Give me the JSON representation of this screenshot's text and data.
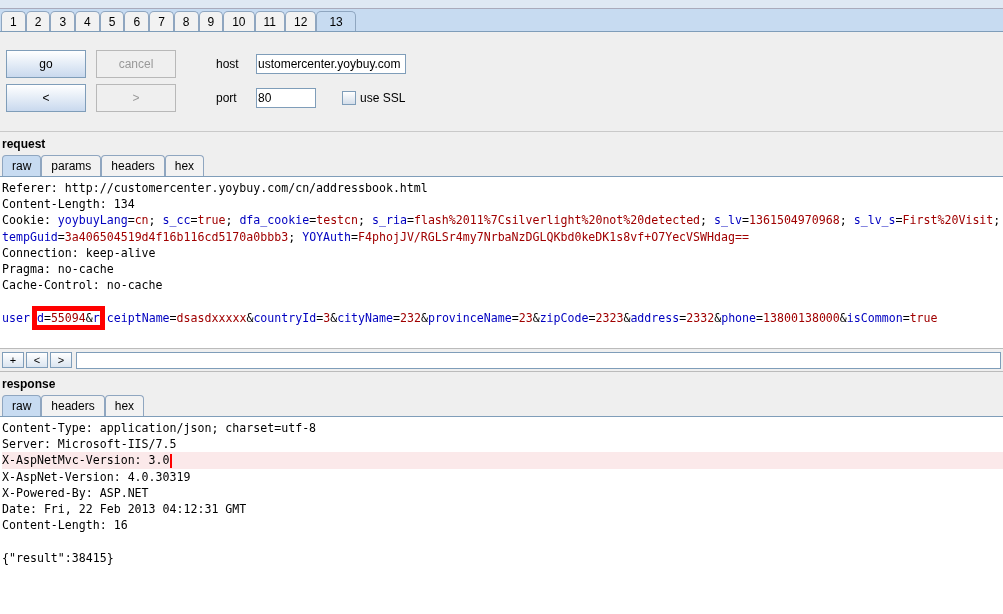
{
  "tabs": [
    {
      "label": "1",
      "selected": false
    },
    {
      "label": "2",
      "selected": false
    },
    {
      "label": "3",
      "selected": false
    },
    {
      "label": "4",
      "selected": false
    },
    {
      "label": "5",
      "selected": false
    },
    {
      "label": "6",
      "selected": false
    },
    {
      "label": "7",
      "selected": false
    },
    {
      "label": "8",
      "selected": false
    },
    {
      "label": "9",
      "selected": false
    },
    {
      "label": "10",
      "selected": false
    },
    {
      "label": "11",
      "selected": false
    },
    {
      "label": "12",
      "selected": false
    },
    {
      "label": "13",
      "selected": true
    }
  ],
  "controls": {
    "buttons": [
      {
        "label": "go",
        "disabled": false
      },
      {
        "label": "cancel",
        "disabled": true
      },
      {
        "label": "<",
        "disabled": false
      },
      {
        "label": ">",
        "disabled": true
      }
    ],
    "host": {
      "label": "host",
      "value": "ustomercenter.yoybuy.com"
    },
    "port": {
      "label": "port",
      "value": "80"
    },
    "ssl": {
      "label": "use SSL",
      "checked": false
    }
  },
  "request": {
    "title": "request",
    "tabs": [
      {
        "label": "raw",
        "selected": true
      },
      {
        "label": "params",
        "selected": false
      },
      {
        "label": "headers",
        "selected": false
      },
      {
        "label": "hex",
        "selected": false
      }
    ],
    "lines": [
      [
        {
          "kind": "plain",
          "text": "Referer: http://customercenter.yoybuy.com/cn/addressbook.html"
        }
      ],
      [
        {
          "kind": "plain",
          "text": "Content-Length: 134"
        }
      ],
      [
        {
          "kind": "plain",
          "text": "Cookie: "
        },
        {
          "kind": "key",
          "text": "yoybuyLang"
        },
        {
          "kind": "sep",
          "text": "="
        },
        {
          "kind": "value",
          "text": "cn"
        },
        {
          "kind": "sep",
          "text": "; "
        },
        {
          "kind": "key",
          "text": "s_cc"
        },
        {
          "kind": "sep",
          "text": "="
        },
        {
          "kind": "value",
          "text": "true"
        },
        {
          "kind": "sep",
          "text": "; "
        },
        {
          "kind": "key",
          "text": "dfa_cookie"
        },
        {
          "kind": "sep",
          "text": "="
        },
        {
          "kind": "value",
          "text": "testcn"
        },
        {
          "kind": "sep",
          "text": "; "
        },
        {
          "kind": "key",
          "text": "s_ria"
        },
        {
          "kind": "sep",
          "text": "="
        },
        {
          "kind": "value",
          "text": "flash%2011%7Csilverlight%20not%20detected"
        },
        {
          "kind": "sep",
          "text": "; "
        },
        {
          "kind": "key",
          "text": "s_lv"
        },
        {
          "kind": "sep",
          "text": "="
        },
        {
          "kind": "value",
          "text": "1361504970968"
        },
        {
          "kind": "sep",
          "text": "; "
        },
        {
          "kind": "key",
          "text": "s_lv_s"
        },
        {
          "kind": "sep",
          "text": "="
        },
        {
          "kind": "value",
          "text": "First%20Visit"
        },
        {
          "kind": "sep",
          "text": ";"
        }
      ],
      [
        {
          "kind": "key",
          "text": "tempGuid"
        },
        {
          "kind": "sep",
          "text": "="
        },
        {
          "kind": "value",
          "text": "3a406504519d4f16b116cd5170a0bbb3"
        },
        {
          "kind": "sep",
          "text": "; "
        },
        {
          "kind": "key",
          "text": "YOYAuth"
        },
        {
          "kind": "sep",
          "text": "="
        },
        {
          "kind": "value",
          "text": "F4phojJV/RGLSr4my7NrbaNzDGLQKbd0keDK1s8vf+O7YecVSWHdag=="
        }
      ],
      [
        {
          "kind": "plain",
          "text": "Connection: keep-alive"
        }
      ],
      [
        {
          "kind": "plain",
          "text": "Pragma: no-cache"
        }
      ],
      [
        {
          "kind": "plain",
          "text": "Cache-Control: no-cache"
        }
      ]
    ],
    "body": [
      {
        "kind": "key",
        "text": "user"
      },
      {
        "kind": "mark",
        "children": [
          {
            "kind": "key",
            "text": "d"
          },
          {
            "kind": "sep",
            "text": "="
          },
          {
            "kind": "value",
            "text": "55094"
          },
          {
            "kind": "sep",
            "text": "&"
          },
          {
            "kind": "key",
            "text": "r"
          }
        ]
      },
      {
        "kind": "key",
        "text": "ceiptName"
      },
      {
        "kind": "sep",
        "text": "="
      },
      {
        "kind": "value",
        "text": "dsasdxxxxx"
      },
      {
        "kind": "sep",
        "text": "&"
      },
      {
        "kind": "key",
        "text": "countryId"
      },
      {
        "kind": "sep",
        "text": "="
      },
      {
        "kind": "value",
        "text": "3"
      },
      {
        "kind": "sep",
        "text": "&"
      },
      {
        "kind": "key",
        "text": "cityName"
      },
      {
        "kind": "sep",
        "text": "="
      },
      {
        "kind": "value",
        "text": "232"
      },
      {
        "kind": "sep",
        "text": "&"
      },
      {
        "kind": "key",
        "text": "provinceName"
      },
      {
        "kind": "sep",
        "text": "="
      },
      {
        "kind": "value",
        "text": "23"
      },
      {
        "kind": "sep",
        "text": "&"
      },
      {
        "kind": "key",
        "text": "zipCode"
      },
      {
        "kind": "sep",
        "text": "="
      },
      {
        "kind": "value",
        "text": "2323"
      },
      {
        "kind": "sep",
        "text": "&"
      },
      {
        "kind": "key",
        "text": "address"
      },
      {
        "kind": "sep",
        "text": "="
      },
      {
        "kind": "value",
        "text": "2332"
      },
      {
        "kind": "sep",
        "text": "&"
      },
      {
        "kind": "key",
        "text": "phone"
      },
      {
        "kind": "sep",
        "text": "="
      },
      {
        "kind": "value",
        "text": "13800138000"
      },
      {
        "kind": "sep",
        "text": "&"
      },
      {
        "kind": "key",
        "text": "isCommon"
      },
      {
        "kind": "sep",
        "text": "="
      },
      {
        "kind": "value",
        "text": "true"
      }
    ],
    "nav_buttons": [
      "+",
      "<",
      ">"
    ]
  },
  "response": {
    "title": "response",
    "tabs": [
      {
        "label": "raw",
        "selected": true
      },
      {
        "label": "headers",
        "selected": false
      },
      {
        "label": "hex",
        "selected": false
      }
    ],
    "lines": [
      {
        "text": "Content-Type: application/json; charset=utf-8",
        "highlighted": false
      },
      {
        "text": "Server: Microsoft-IIS/7.5",
        "highlighted": false
      },
      {
        "text": "X-AspNetMvc-Version: 3.0",
        "highlighted": true
      },
      {
        "text": "X-AspNet-Version: 4.0.30319",
        "highlighted": false
      },
      {
        "text": "X-Powered-By: ASP.NET",
        "highlighted": false
      },
      {
        "text": "Date: Fri, 22 Feb 2013 04:12:31 GMT",
        "highlighted": false
      },
      {
        "text": "Content-Length: 16",
        "highlighted": false
      }
    ],
    "body": "{\"result\":38415}"
  }
}
